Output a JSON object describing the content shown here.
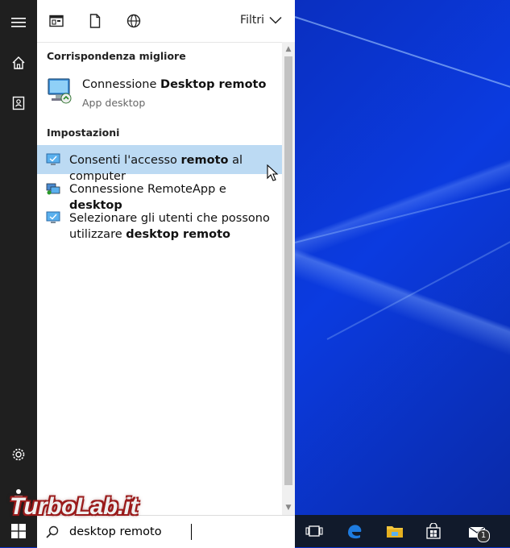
{
  "filters_label": "Filtri",
  "best_match": {
    "section_label": "Corrispondenza migliore",
    "title_prefix": "Connessione ",
    "title_bold": "Desktop remoto",
    "subtitle": "App desktop"
  },
  "settings": {
    "section_label": "Impostazioni",
    "items": [
      {
        "pre": "Consenti l'accesso ",
        "bold": "remoto",
        "post": " al computer",
        "selected": true
      },
      {
        "pre": "Connessione RemoteApp e ",
        "bold": "desktop",
        "post": ""
      },
      {
        "pre": "Selezionare gli utenti che possono",
        "line2_pre": "utilizzare ",
        "line2_bold": "desktop remoto"
      }
    ]
  },
  "search": {
    "value": "desktop remoto"
  },
  "taskbar": {
    "mail_badge": "1"
  },
  "watermark": "TurboLab.it",
  "colors": {
    "selected_row": "#bcdaf3",
    "rail": "#1f1f1f",
    "taskbar": "#111a2b",
    "desktop": "#0b3be0"
  }
}
